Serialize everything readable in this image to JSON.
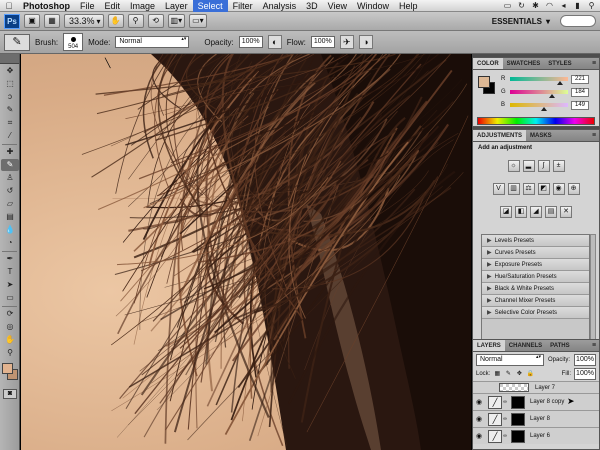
{
  "menubar": {
    "app": "Photoshop",
    "items": [
      "File",
      "Edit",
      "Image",
      "Layer",
      "Select",
      "Filter",
      "Analysis",
      "3D",
      "View",
      "Window",
      "Help"
    ],
    "active_index": 4
  },
  "appbar": {
    "logo": "Ps",
    "zoom": "33.3%",
    "workspace": "ESSENTIALS"
  },
  "options": {
    "brush_label": "Brush:",
    "brush_size": "504",
    "mode_label": "Mode:",
    "mode_value": "Normal",
    "opacity_label": "Opacity:",
    "opacity_value": "100%",
    "flow_label": "Flow:",
    "flow_value": "100%"
  },
  "color_panel": {
    "tabs": [
      "COLOR",
      "SWATCHES",
      "STYLES"
    ],
    "sliders": [
      {
        "label": "R",
        "value": "221",
        "fraction": 0.867
      },
      {
        "label": "G",
        "value": "184",
        "fraction": 0.722
      },
      {
        "label": "B",
        "value": "149",
        "fraction": 0.584
      }
    ],
    "fg_color": "#ddb895",
    "bg_color": "#000000"
  },
  "adjustments_panel": {
    "tabs": [
      "ADJUSTMENTS",
      "MASKS"
    ],
    "title": "Add an adjustment",
    "presets": [
      "Levels Presets",
      "Curves Presets",
      "Exposure Presets",
      "Hue/Saturation Presets",
      "Black & White Presets",
      "Channel Mixer Presets",
      "Selective Color Presets"
    ]
  },
  "layers_panel": {
    "tabs": [
      "LAYERS",
      "CHANNELS",
      "PATHS"
    ],
    "blend_mode": "Normal",
    "opacity_label": "Opacity:",
    "opacity_value": "100%",
    "lock_label": "Lock:",
    "fill_label": "Fill:",
    "fill_value": "100%",
    "layers": [
      {
        "name": "Layer 7",
        "kind": "plain"
      },
      {
        "name": "Layer 8 copy",
        "kind": "masked"
      },
      {
        "name": "Layer 8",
        "kind": "masked"
      },
      {
        "name": "Layer 6",
        "kind": "masked"
      }
    ]
  },
  "colors": {
    "skin": "#e2b38f",
    "accent": "#3a6fd8"
  }
}
